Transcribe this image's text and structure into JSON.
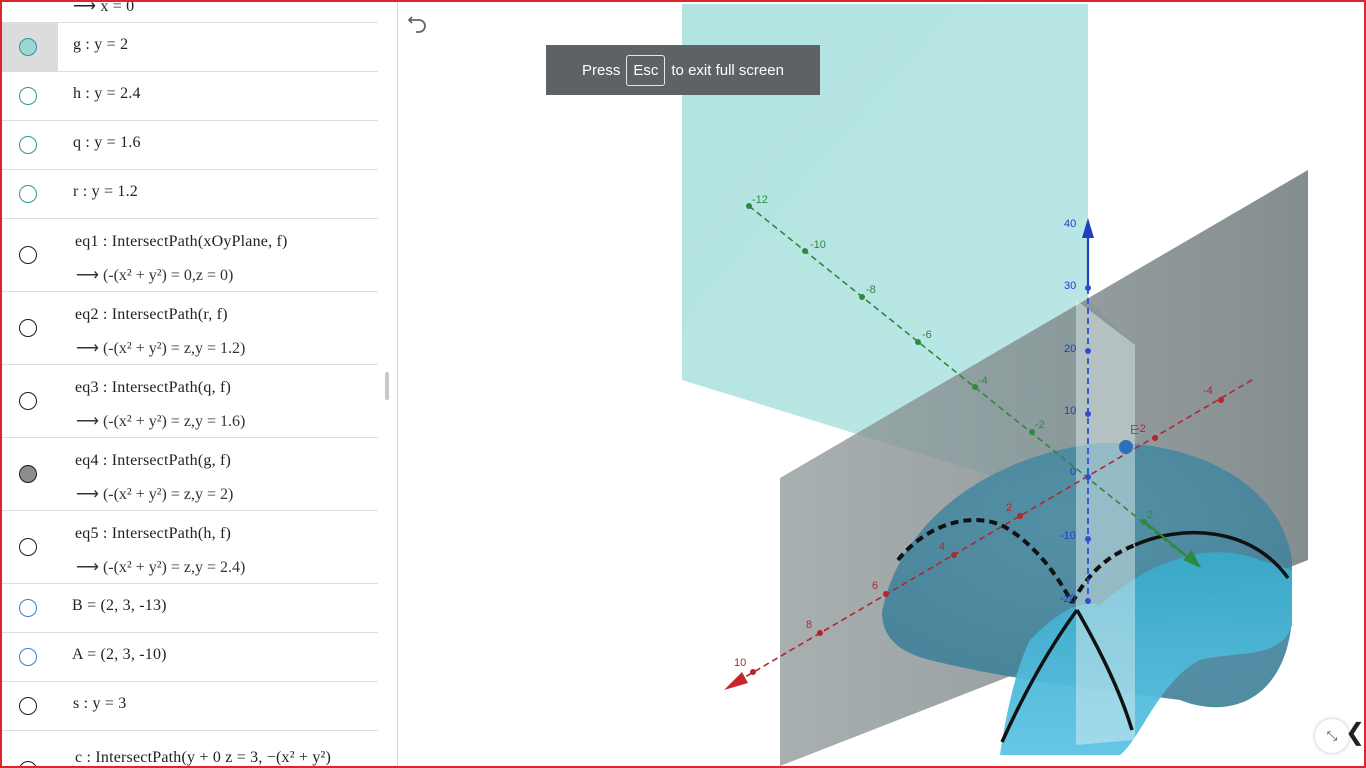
{
  "algebra": {
    "top_partial": "⟶ x = 0",
    "rows": [
      {
        "text": "g : y = 2"
      },
      {
        "text": "h : y = 2.4"
      },
      {
        "text": "q : y = 1.6"
      },
      {
        "text": "r : y = 1.2"
      },
      {
        "text": "eq1 : IntersectPath(xOyPlane, f)",
        "value": "⟶ (-(x² + y²) = 0,z = 0)"
      },
      {
        "text": "eq2 : IntersectPath(r, f)",
        "value": "⟶ (-(x² + y²) = z,y = 1.2)"
      },
      {
        "text": "eq3 : IntersectPath(q, f)",
        "value": "⟶ (-(x² + y²) = z,y = 1.6)"
      },
      {
        "text": "eq4 : IntersectPath(g, f)",
        "value": "⟶ (-(x² + y²) = z,y = 2)"
      },
      {
        "text": "eq5 : IntersectPath(h, f)",
        "value": "⟶ (-(x² + y²) = z,y = 2.4)"
      },
      {
        "text": "B = (2, 3, -13)"
      },
      {
        "text": "A = (2, 3, -10)"
      },
      {
        "text": "s : y = 3"
      },
      {
        "text": "c : IntersectPath(y + 0 z = 3, −(x² + y²)"
      }
    ]
  },
  "toast": {
    "press": "Press",
    "key": "Esc",
    "rest": "to exit full screen"
  },
  "view3d": {
    "point_label": "E",
    "x_ticks": [
      "10",
      "8",
      "6",
      "4",
      "2",
      "-2",
      "-4"
    ],
    "y_ticks": [
      "-12",
      "-10",
      "-8",
      "-6",
      "-4",
      "-2",
      "2"
    ],
    "z_ticks": [
      "40",
      "30",
      "20",
      "10",
      "0",
      "-10",
      "-20"
    ]
  },
  "colors": {
    "frame": "#d9262f",
    "x_axis": "#b3262f",
    "y_axis": "#2c8a3e",
    "z_axis": "#1f3fc4",
    "plane": "#a5dfdc",
    "surface": "#4fb7d4"
  }
}
